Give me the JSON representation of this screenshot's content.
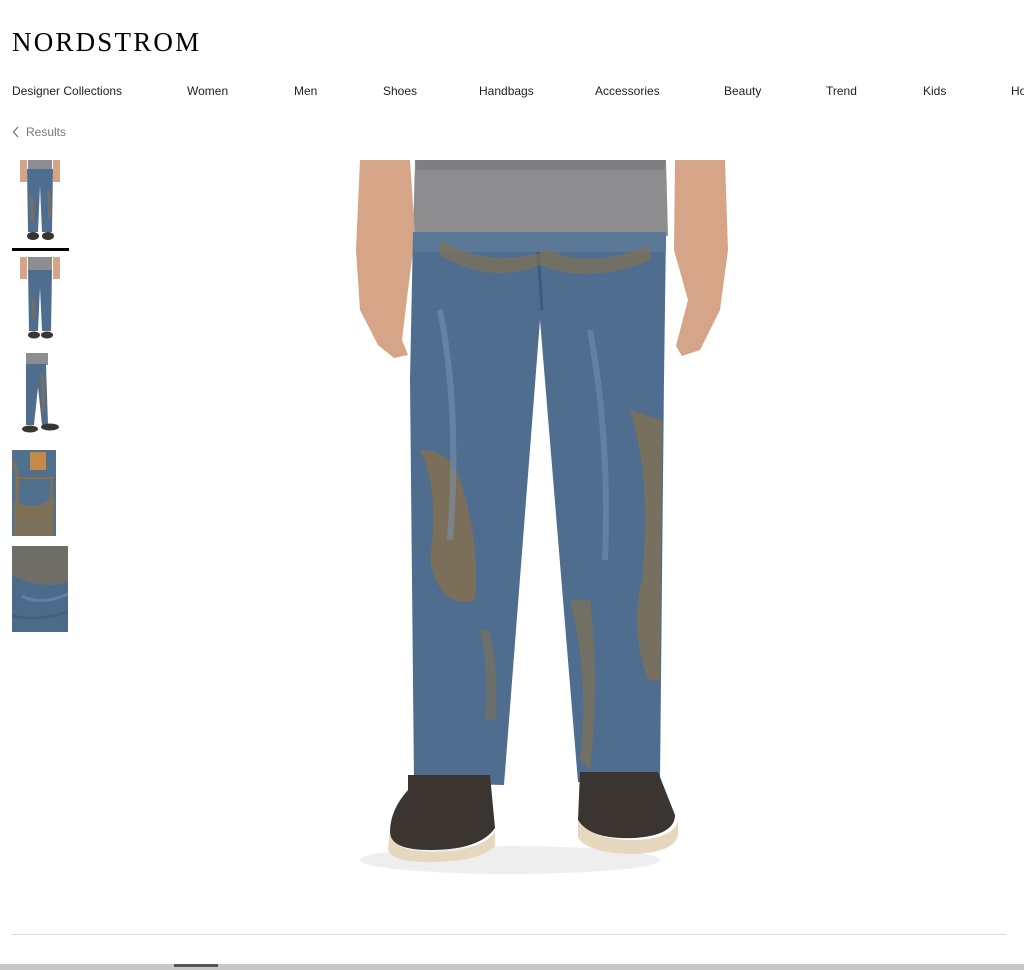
{
  "header": {
    "logo": "NORDSTROM"
  },
  "nav": {
    "items": [
      "Designer Collections",
      "Women",
      "Men",
      "Shoes",
      "Handbags",
      "Accessories",
      "Beauty",
      "Trend",
      "Kids",
      "Ho"
    ]
  },
  "breadcrumb": {
    "back_icon": "chevron-left-icon",
    "label": "Results"
  },
  "gallery": {
    "selected_index": 0,
    "thumbnails": [
      "front-full-view",
      "front-full-view-alt",
      "side-view",
      "back-pocket-detail",
      "fabric-detail"
    ],
    "main_image": "muddy-jeans-front-view"
  },
  "colors": {
    "denim": "#4f6e8f",
    "mud": "#8a7048",
    "shirt": "#8d8d8f",
    "skin": "#d6a487",
    "boot": "#3a3531",
    "sole": "#e6d8bf"
  }
}
